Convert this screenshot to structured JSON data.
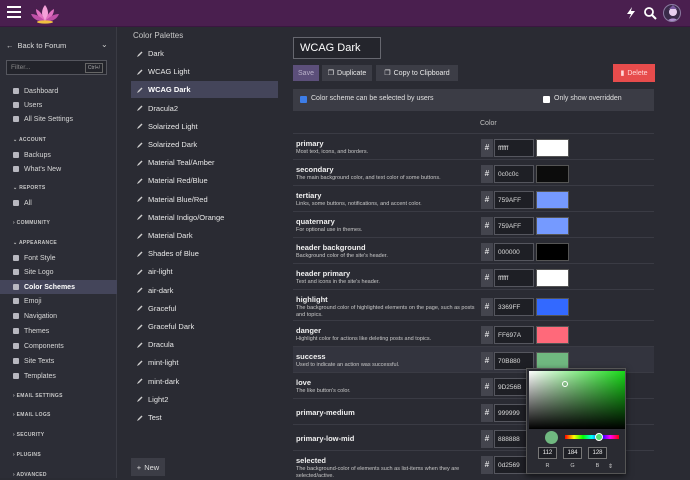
{
  "sidebar": {
    "back_label": "Back to Forum",
    "filter_placeholder": "Filter...",
    "filter_shortcut": "Ctrl+/",
    "items_top": [
      {
        "label": "Dashboard",
        "icon": "home-icon"
      },
      {
        "label": "Users",
        "icon": "users-icon"
      },
      {
        "label": "All Site Settings",
        "icon": "list-icon"
      }
    ],
    "sections": {
      "account": "ACCOUNT",
      "reports": "REPORTS",
      "community": "COMMUNITY",
      "appearance": "APPEARANCE",
      "email_settings": "EMAIL SETTINGS",
      "email_logs": "EMAIL LOGS",
      "security": "SECURITY",
      "plugins": "PLUGINS",
      "advanced": "ADVANCED"
    },
    "items_account": [
      {
        "label": "Backups"
      },
      {
        "label": "What's New"
      }
    ],
    "items_reports": [
      {
        "label": "All"
      }
    ],
    "items_appearance": [
      {
        "label": "Font Style"
      },
      {
        "label": "Site Logo"
      },
      {
        "label": "Color Schemes",
        "active": true
      },
      {
        "label": "Emoji"
      },
      {
        "label": "Navigation"
      },
      {
        "label": "Themes"
      },
      {
        "label": "Components"
      },
      {
        "label": "Site Texts"
      },
      {
        "label": "Templates"
      }
    ]
  },
  "palettes": {
    "heading": "Color Palettes",
    "items": [
      "Dark",
      "WCAG Light",
      "WCAG Dark",
      "Dracula2",
      "Solarized Light",
      "Solarized Dark",
      "Material Teal/Amber",
      "Material Red/Blue",
      "Material Blue/Red",
      "Material Indigo/Orange",
      "Material Dark",
      "Shades of Blue",
      "air-light",
      "air-dark",
      "Graceful",
      "Graceful Dark",
      "Dracula",
      "mint-light",
      "mint-dark",
      "Light2",
      "Test"
    ],
    "active_index": 2,
    "new_label": "New"
  },
  "editor": {
    "name_value": "WCAG Dark",
    "save_label": "Save",
    "duplicate_label": "Duplicate",
    "copy_label": "Copy to Clipboard",
    "delete_label": "Delete",
    "user_selectable_label": "Color scheme can be selected by users",
    "user_selectable_checked": true,
    "show_overridden_label": "Only show overridden",
    "show_overridden_checked": false,
    "color_column_label": "Color",
    "colors": [
      {
        "name": "primary",
        "desc": "Most text, icons, and borders.",
        "hex": "ffffff",
        "swatch": "#ffffff"
      },
      {
        "name": "secondary",
        "desc": "The main background color, and text color of some buttons.",
        "hex": "0c0c0c",
        "swatch": "#0c0c0c"
      },
      {
        "name": "tertiary",
        "desc": "Links, some buttons, notifications, and accent color.",
        "hex": "759AFF",
        "swatch": "#759aff"
      },
      {
        "name": "quaternary",
        "desc": "For optional use in themes.",
        "hex": "759AFF",
        "swatch": "#759aff"
      },
      {
        "name": "header background",
        "desc": "Background color of the site's header.",
        "hex": "000000",
        "swatch": "#000000"
      },
      {
        "name": "header primary",
        "desc": "Text and icons in the site's header.",
        "hex": "ffffff",
        "swatch": "#ffffff"
      },
      {
        "name": "highlight",
        "desc": "The background color of highlighted elements on the page, such as posts and topics.",
        "hex": "3369FF",
        "swatch": "#3369ff"
      },
      {
        "name": "danger",
        "desc": "Highlight color for actions like deleting posts and topics.",
        "hex": "FF697A",
        "swatch": "#ff697a"
      },
      {
        "name": "success",
        "desc": "Used to indicate an action was successful.",
        "hex": "70B880",
        "swatch": "#70b880"
      },
      {
        "name": "love",
        "desc": "The like button's color.",
        "hex": "9D256B",
        "swatch": "#9d256b"
      },
      {
        "name": "primary-medium",
        "desc": "",
        "hex": "999999",
        "swatch": "#999999"
      },
      {
        "name": "primary-low-mid",
        "desc": "",
        "hex": "888888",
        "swatch": "#888888"
      },
      {
        "name": "selected",
        "desc": "The background-color of elements such as list-items when they are selected/active.",
        "hex": "0d2569",
        "swatch": "#0d2569"
      }
    ]
  },
  "picker": {
    "r": "112",
    "g": "184",
    "b": "128",
    "r_label": "R",
    "g_label": "G",
    "b_label": "B",
    "preview_color": "#70b880"
  }
}
